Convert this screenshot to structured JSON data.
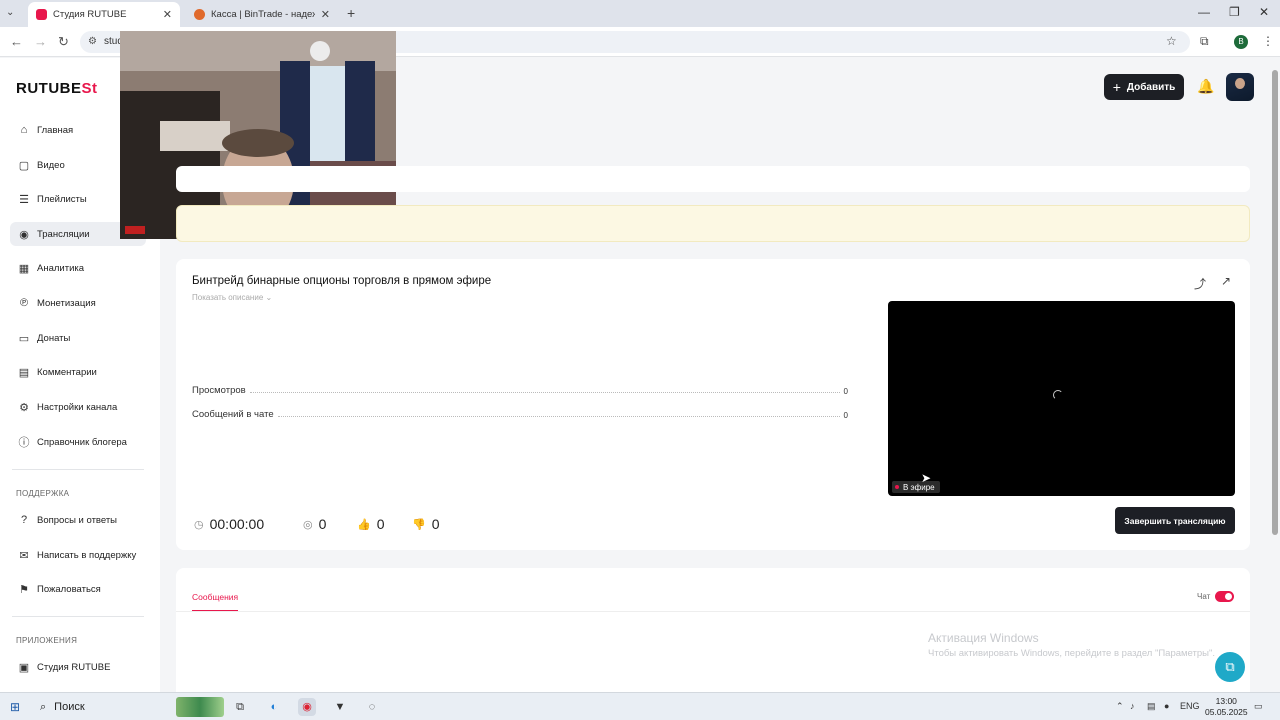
{
  "browser": {
    "tabs": [
      {
        "label": "Студия RUTUBE",
        "active": true,
        "favicon_color": "#e8174c"
      },
      {
        "label": "Касса | BinTrade - надежная пл",
        "active": false,
        "favicon_color": "#e06a2c"
      }
    ],
    "url": "stud",
    "new_tab": "+"
  },
  "sidebar": {
    "logo_main": "RUTUBE",
    "logo_accent": "St",
    "items": [
      {
        "label": "Главная",
        "icon": "home-icon",
        "glyph": "⌂"
      },
      {
        "label": "Видео",
        "icon": "video-icon",
        "glyph": "▢"
      },
      {
        "label": "Плейлисты",
        "icon": "playlist-icon",
        "glyph": "☰"
      },
      {
        "label": "Трансляции",
        "icon": "broadcast-icon",
        "glyph": "◉",
        "active": true
      },
      {
        "label": "Аналитика",
        "icon": "analytics-icon",
        "glyph": "▦"
      },
      {
        "label": "Монетизация",
        "icon": "monetization-icon",
        "glyph": "℗"
      },
      {
        "label": "Донаты",
        "icon": "donate-icon",
        "glyph": "▭"
      },
      {
        "label": "Комментарии",
        "icon": "comments-icon",
        "glyph": "▤"
      },
      {
        "label": "Настройки канала",
        "icon": "settings-icon",
        "glyph": "⚙"
      },
      {
        "label": "Справочник блогера",
        "icon": "info-icon",
        "glyph": "ⓘ"
      }
    ],
    "support_title": "ПОДДЕРЖКА",
    "support_items": [
      {
        "label": "Вопросы и ответы",
        "icon": "faq-icon",
        "glyph": "?"
      },
      {
        "label": "Написать в поддержку",
        "icon": "mail-icon",
        "glyph": "✉"
      },
      {
        "label": "Пожаловаться",
        "icon": "flag-icon",
        "glyph": "⚑"
      }
    ],
    "apps_title": "ПРИЛОЖЕНИЯ",
    "apps_items": [
      {
        "label": "Студия RUTUBE",
        "icon": "studio-app-icon",
        "glyph": "▣"
      }
    ]
  },
  "header": {
    "add_label": "Добавить"
  },
  "stream": {
    "title": "Бинтрейд бинарные опционы торговля в прямом эфире",
    "show_description": "Показать описание",
    "stats": [
      {
        "label": "Просмотров",
        "value": "0"
      },
      {
        "label": "Сообщений в чате",
        "value": "0"
      }
    ],
    "live_label": "В эфире",
    "duration": "00:00:00",
    "viewers": "0",
    "likes": "0",
    "dislikes": "0",
    "end_button": "Завершить трансляцию"
  },
  "messages": {
    "tab_label": "Сообщения",
    "chat_label": "Чат",
    "chat_enabled": true
  },
  "watermark": {
    "title": "Активация Windows",
    "subtitle": "Чтобы активировать Windows, перейдите в раздел \"Параметры\"."
  },
  "taskbar": {
    "search_label": "Поиск",
    "lang": "ENG",
    "time": "13:00",
    "date": "05.05.2025"
  }
}
